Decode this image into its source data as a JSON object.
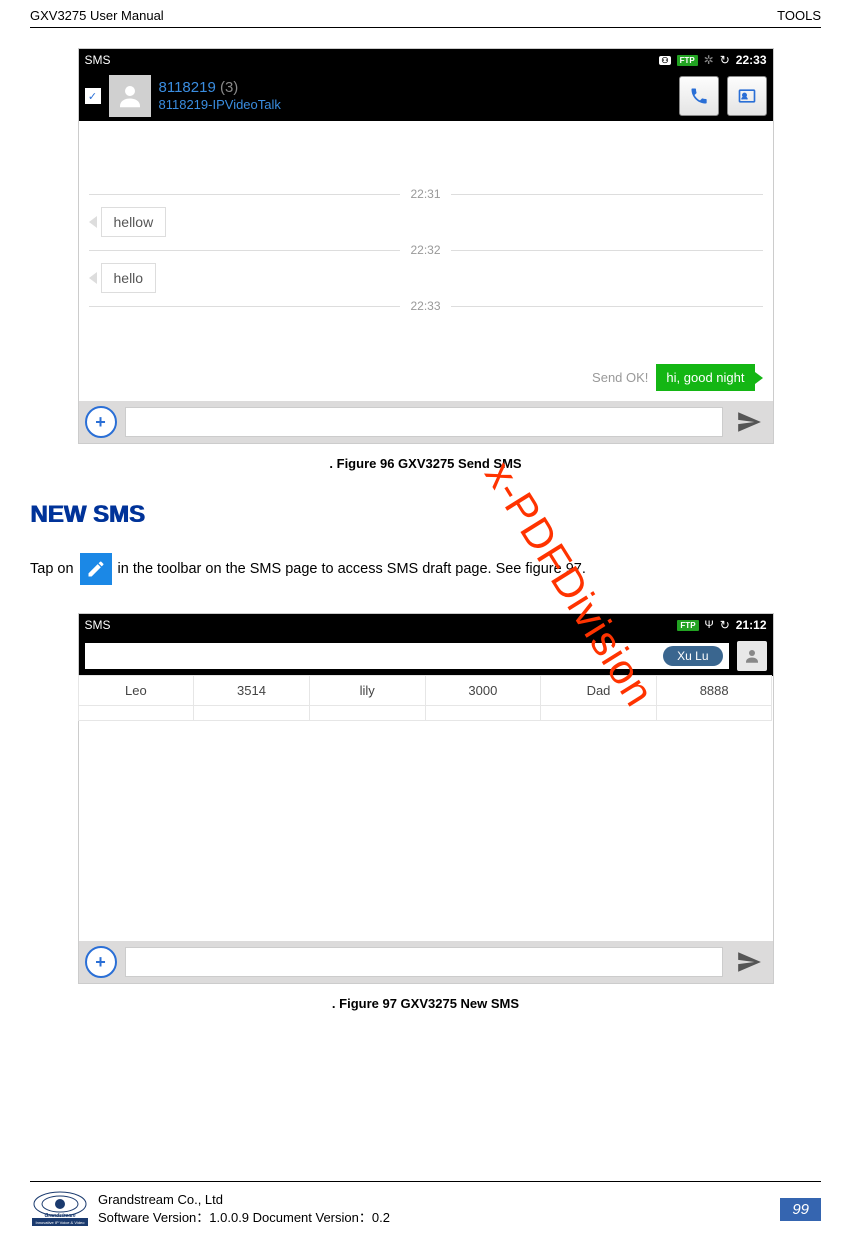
{
  "header": {
    "left": "GXV3275 User Manual",
    "right": "TOOLS"
  },
  "fig1": {
    "statusbar": {
      "title": "SMS",
      "time": "22:33"
    },
    "contact": {
      "number": "8118219",
      "count": "(3)",
      "sub": "8118219-IPVideoTalk"
    },
    "chat": {
      "t1": "22:31",
      "m1": "hellow",
      "t2": "22:32",
      "m2": "hello",
      "t3": "22:33",
      "sendok": "Send OK!",
      "out": "hi, good night"
    },
    "caption": ". Figure 96 GXV3275 Send SMS"
  },
  "section": {
    "heading": "NEW SMS",
    "para_before": "Tap on",
    "para_after": "in the toolbar on the SMS page to access SMS draft page. See figure 97."
  },
  "fig2": {
    "statusbar": {
      "title": "SMS",
      "time": "21:12"
    },
    "chip": "Xu Lu",
    "suggest": [
      {
        "name": "Leo",
        "num": "3514"
      },
      {
        "name": "lily",
        "num": "3000"
      },
      {
        "name": "Dad",
        "num": "8888"
      }
    ],
    "caption": ". Figure 97 GXV3275 New SMS"
  },
  "watermark": "x-PDFDivision",
  "footer": {
    "company": "Grandstream Co., Ltd",
    "version": "Software Version：1.0.0.9 Document Version：0.2",
    "page": "99"
  }
}
